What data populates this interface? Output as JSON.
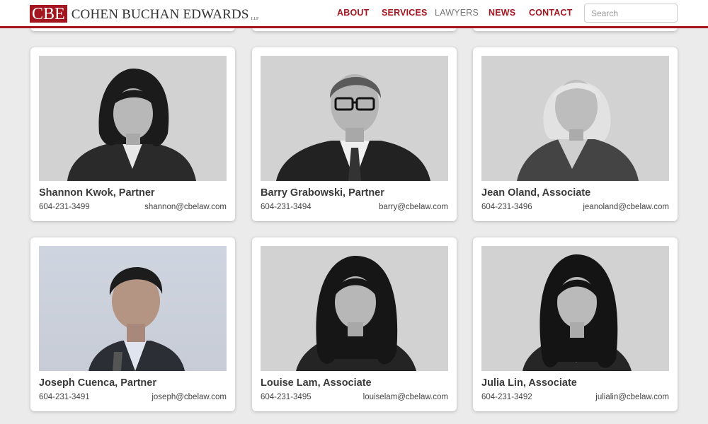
{
  "brand": {
    "mark": "CBE",
    "name": "COHEN BUCHAN EDWARDS",
    "suffix": "LLP",
    "accent_color": "#a3151f"
  },
  "nav": {
    "items": [
      {
        "label": "ABOUT"
      },
      {
        "label": "SERVICES"
      },
      {
        "label": "LAWYERS",
        "active": true
      },
      {
        "label": "NEWS"
      },
      {
        "label": "CONTACT"
      }
    ]
  },
  "search": {
    "placeholder": "Search",
    "value": ""
  },
  "lawyers": [
    {
      "name": "Shannon Kwok, Partner",
      "phone": "604-231-3499",
      "email": "shannon@cbelaw.com",
      "photo": "headshot-photo"
    },
    {
      "name": "Barry Grabowski, Partner",
      "phone": "604-231-3494",
      "email": "barry@cbelaw.com",
      "photo": "headshot-photo"
    },
    {
      "name": "Jean Oland, Associate",
      "phone": "604-231-3496",
      "email": "jeanoland@cbelaw.com",
      "photo": "headshot-photo"
    },
    {
      "name": "Joseph Cuenca, Partner",
      "phone": "604-231-3491",
      "email": "joseph@cbelaw.com",
      "photo": "headshot-photo"
    },
    {
      "name": "Louise Lam, Associate",
      "phone": "604-231-3495",
      "email": "louiselam@cbelaw.com",
      "photo": "headshot-photo"
    },
    {
      "name": "Julia Lin, Associate",
      "phone": "604-231-3492",
      "email": "julialin@cbelaw.com",
      "photo": "headshot-photo"
    }
  ]
}
